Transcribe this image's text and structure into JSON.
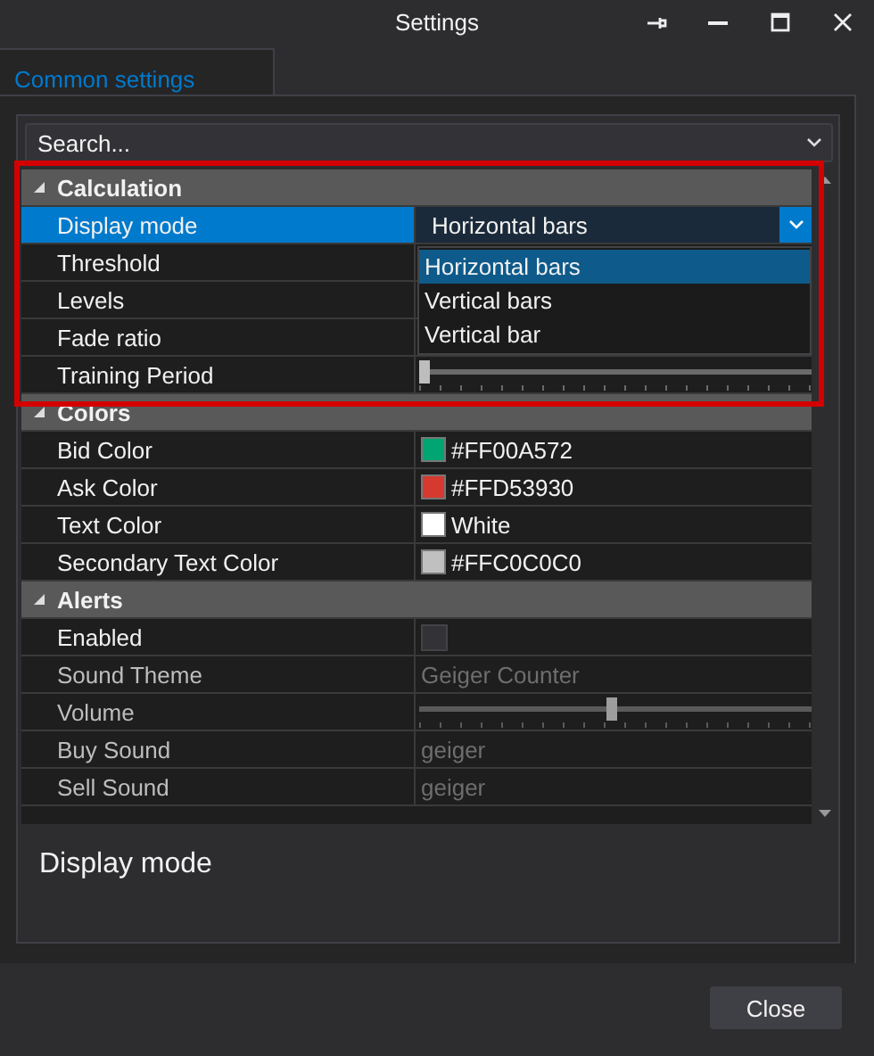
{
  "window": {
    "title": "Settings"
  },
  "tabs": [
    {
      "label": "Common settings",
      "selected": true
    }
  ],
  "search": {
    "placeholder": "Search..."
  },
  "categories": [
    {
      "name": "Calculation",
      "expanded": true,
      "properties": [
        {
          "name": "Display mode",
          "kind": "dropdown",
          "value": "Horizontal bars",
          "selected": true,
          "disabled": false,
          "options": [
            {
              "label": "Horizontal bars",
              "selected": true
            },
            {
              "label": "Vertical bars",
              "selected": false
            },
            {
              "label": "Vertical bar",
              "selected": false
            }
          ]
        },
        {
          "name": "Threshold",
          "kind": "text",
          "selected": false,
          "disabled": false
        },
        {
          "name": "Levels",
          "kind": "text",
          "selected": false,
          "disabled": false
        },
        {
          "name": "Fade ratio",
          "kind": "text",
          "selected": false,
          "disabled": false
        },
        {
          "name": "Training Period",
          "kind": "slider",
          "level": 0,
          "selected": false,
          "disabled": false
        }
      ]
    },
    {
      "name": "Colors",
      "expanded": true,
      "properties": [
        {
          "name": "Bid Color",
          "kind": "color",
          "value": "#FF00A572",
          "color": "#00a572",
          "selected": false,
          "disabled": false
        },
        {
          "name": "Ask Color",
          "kind": "color",
          "value": "#FFD53930",
          "color": "#d53930",
          "selected": false,
          "disabled": false
        },
        {
          "name": "Text Color",
          "kind": "color",
          "value": "White",
          "color": "#ffffff",
          "selected": false,
          "disabled": false
        },
        {
          "name": "Secondary Text Color",
          "kind": "color",
          "value": "#FFC0C0C0",
          "color": "#c0c0c0",
          "selected": false,
          "disabled": false
        }
      ]
    },
    {
      "name": "Alerts",
      "expanded": true,
      "properties": [
        {
          "name": "Enabled",
          "kind": "checkbox",
          "checked": false,
          "selected": false,
          "disabled": false
        },
        {
          "name": "Sound Theme",
          "kind": "text",
          "value": "Geiger Counter",
          "selected": false,
          "disabled": true
        },
        {
          "name": "Volume",
          "kind": "slider",
          "level": 0.49,
          "selected": false,
          "disabled": true
        },
        {
          "name": "Buy Sound",
          "kind": "text",
          "value": "geiger",
          "selected": false,
          "disabled": true
        },
        {
          "name": "Sell Sound",
          "kind": "text",
          "value": "geiger",
          "selected": false,
          "disabled": true
        }
      ]
    }
  ],
  "description": "Display mode",
  "buttons": [
    {
      "label": "Close"
    }
  ]
}
